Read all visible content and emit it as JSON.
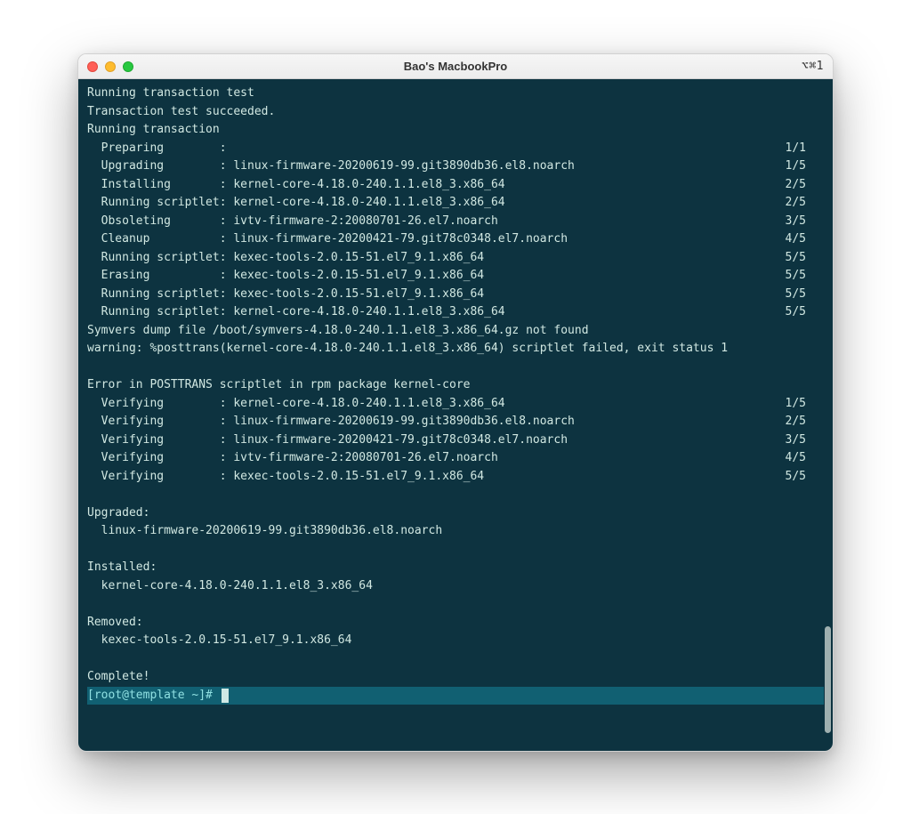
{
  "window": {
    "title": "Bao's MacbookPro",
    "shortcut": "⌥⌘1"
  },
  "terminal": {
    "headerLines": [
      "Running transaction test",
      "Transaction test succeeded.",
      "Running transaction"
    ],
    "steps": [
      {
        "label": "Preparing",
        "pkg": "",
        "count": "1/1"
      },
      {
        "label": "Upgrading",
        "pkg": "linux-firmware-20200619-99.git3890db36.el8.noarch",
        "count": "1/5"
      },
      {
        "label": "Installing",
        "pkg": "kernel-core-4.18.0-240.1.1.el8_3.x86_64",
        "count": "2/5"
      },
      {
        "label": "Running scriptlet",
        "pkg": "kernel-core-4.18.0-240.1.1.el8_3.x86_64",
        "count": "2/5"
      },
      {
        "label": "Obsoleting",
        "pkg": "ivtv-firmware-2:20080701-26.el7.noarch",
        "count": "3/5"
      },
      {
        "label": "Cleanup",
        "pkg": "linux-firmware-20200421-79.git78c0348.el7.noarch",
        "count": "4/5"
      },
      {
        "label": "Running scriptlet",
        "pkg": "kexec-tools-2.0.15-51.el7_9.1.x86_64",
        "count": "5/5"
      },
      {
        "label": "Erasing",
        "pkg": "kexec-tools-2.0.15-51.el7_9.1.x86_64",
        "count": "5/5"
      },
      {
        "label": "Running scriptlet",
        "pkg": "kexec-tools-2.0.15-51.el7_9.1.x86_64",
        "count": "5/5"
      },
      {
        "label": "Running scriptlet",
        "pkg": "kernel-core-4.18.0-240.1.1.el8_3.x86_64",
        "count": "5/5"
      }
    ],
    "postStepLines": [
      "Symvers dump file /boot/symvers-4.18.0-240.1.1.el8_3.x86_64.gz not found",
      "warning: %posttrans(kernel-core-4.18.0-240.1.1.el8_3.x86_64) scriptlet failed, exit status 1"
    ],
    "errorLine": "Error in POSTTRANS scriptlet in rpm package kernel-core",
    "verifying": [
      {
        "label": "Verifying",
        "pkg": "kernel-core-4.18.0-240.1.1.el8_3.x86_64",
        "count": "1/5"
      },
      {
        "label": "Verifying",
        "pkg": "linux-firmware-20200619-99.git3890db36.el8.noarch",
        "count": "2/5"
      },
      {
        "label": "Verifying",
        "pkg": "linux-firmware-20200421-79.git78c0348.el7.noarch",
        "count": "3/5"
      },
      {
        "label": "Verifying",
        "pkg": "ivtv-firmware-2:20080701-26.el7.noarch",
        "count": "4/5"
      },
      {
        "label": "Verifying",
        "pkg": "kexec-tools-2.0.15-51.el7_9.1.x86_64",
        "count": "5/5"
      }
    ],
    "sections": [
      {
        "title": "Upgraded:",
        "items": [
          "linux-firmware-20200619-99.git3890db36.el8.noarch"
        ]
      },
      {
        "title": "Installed:",
        "items": [
          "kernel-core-4.18.0-240.1.1.el8_3.x86_64"
        ]
      },
      {
        "title": "Removed:",
        "items": [
          "kexec-tools-2.0.15-51.el7_9.1.x86_64"
        ]
      }
    ],
    "completeLine": "Complete!",
    "prompt": "[root@template ~]# "
  }
}
